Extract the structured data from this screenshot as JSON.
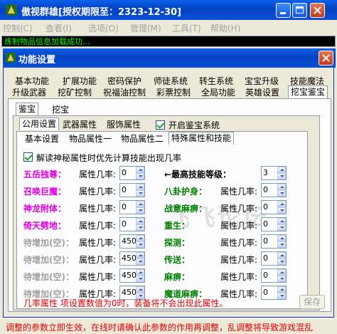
{
  "app": {
    "title": "傲视群雄[授权期限至：2323-12-30]",
    "menu": [
      "控制(C)",
      "查看(I)",
      "选项(O)",
      "管理(M)",
      "工具(T)",
      "帮助(H)"
    ],
    "status_text": "炼制物品信息加载成功...",
    "bottom_warning": "调整的参数立即生效，在线时请确认此参数的作用再调整，乱调整将导致游戏混乱"
  },
  "dialog": {
    "title": "功能设置",
    "tabs_row1": [
      "基本功能",
      "扩展功能",
      "密码保护",
      "师徒系统",
      "转生系统",
      "宝宝升级",
      "技能魔法"
    ],
    "tabs_row2": [
      "升级武器",
      "挖矿控制",
      "祝福油控制",
      "彩票控制",
      "全局功能",
      "英雄设置",
      "挖宝鉴宝"
    ],
    "sub_tabs": [
      "鉴宝",
      "挖宝"
    ],
    "inner_tabs": [
      "公用设置",
      "武器属性",
      "服饰属性"
    ],
    "enable_label": "开启鉴宝系统",
    "attr_tabs": [
      "基本设置",
      "物品属性一",
      "物品属性二",
      "特殊属性和技能"
    ],
    "read_label": "解读神秘属性时优先计算技能出现几率",
    "rate_label": "属性几率:",
    "max_level_label": "←最高技能等级：",
    "max_level_value": "3",
    "left_rows": [
      {
        "name": "五岳独尊：",
        "color": "#e000e0",
        "value": "0"
      },
      {
        "name": "召唤巨魔：",
        "color": "#e000e0",
        "value": "0"
      },
      {
        "name": "神龙附体：",
        "color": "#e000e0",
        "value": "0"
      },
      {
        "name": "倚天劈地：",
        "color": "#e000e0",
        "value": "0"
      },
      {
        "name": "待增加(空)：",
        "color": "#a0a0a0",
        "value": "450"
      },
      {
        "name": "待增加(空)：",
        "color": "#a0a0a0",
        "value": "450"
      },
      {
        "name": "待增加(空)：",
        "color": "#a0a0a0",
        "value": "450"
      },
      {
        "name": "待增加(空)：",
        "color": "#a0a0a0",
        "value": "450"
      }
    ],
    "right_rows": [
      {
        "name": "八卦护身：",
        "color": "#008000",
        "value": "0"
      },
      {
        "name": "战意麻痹：",
        "color": "#008000",
        "value": "0"
      },
      {
        "name": "重生：",
        "color": "#008000",
        "value": "0"
      },
      {
        "name": "探测：",
        "color": "#008000",
        "value": "0"
      },
      {
        "name": "传送：",
        "color": "#008000",
        "value": "0"
      },
      {
        "name": "麻痹：",
        "color": "#008000",
        "value": "0"
      },
      {
        "name": "魔道麻痹：",
        "color": "#008000",
        "value": "0"
      }
    ],
    "note": "几率属性 项设置数值为0时，装备将不会出现此属性。",
    "save_label": "保存",
    "watermark": "飞飞论坛"
  }
}
